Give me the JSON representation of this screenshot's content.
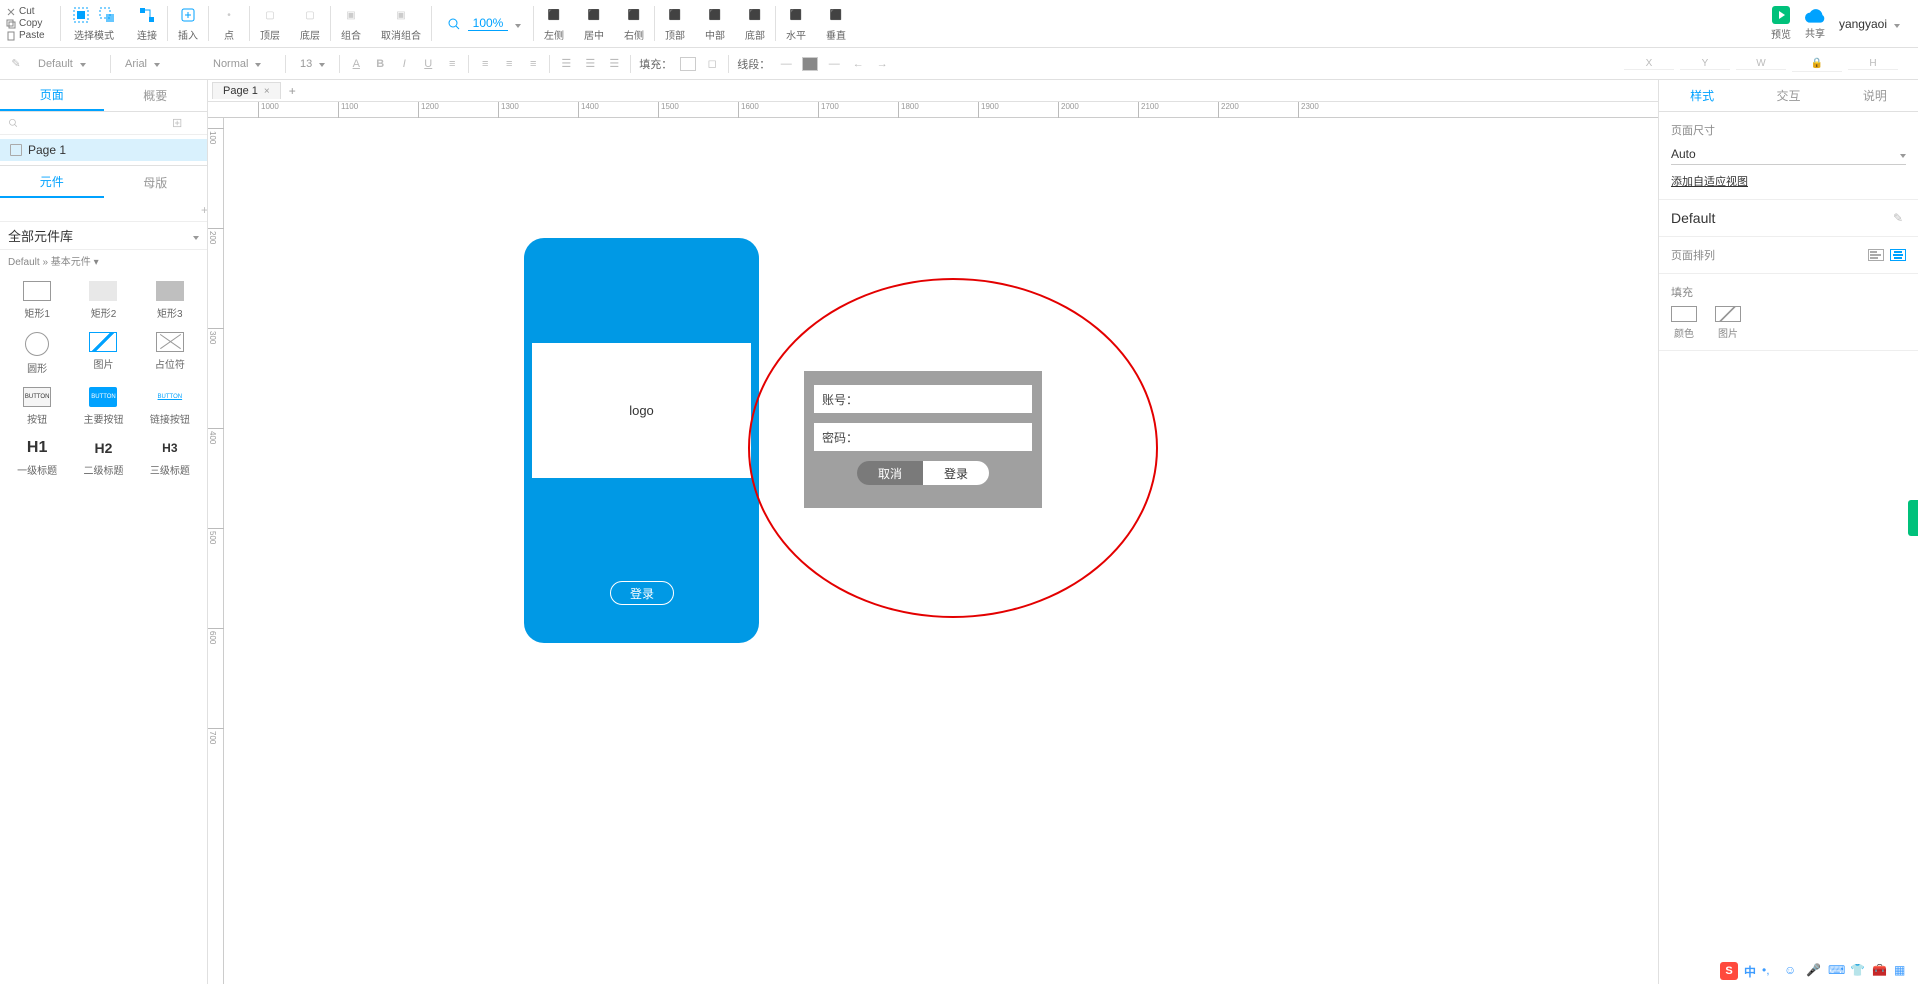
{
  "clipboard": {
    "cut": "Cut",
    "copy": "Copy",
    "paste": "Paste"
  },
  "toolbar": {
    "select_mode": "选择模式",
    "connect": "连接",
    "insert": "插入",
    "point": "点",
    "top_layer": "顶层",
    "bottom_layer": "底层",
    "group": "组合",
    "ungroup": "取消组合",
    "zoom": "100%",
    "align_left": "左侧",
    "align_center": "居中",
    "align_right": "右侧",
    "align_top": "顶部",
    "align_middle": "中部",
    "align_bottom": "底部",
    "dist_h": "水平",
    "dist_v": "垂直",
    "preview": "预览",
    "share": "共享",
    "user": "yangyaoi"
  },
  "toolbar2": {
    "style_default": "Default",
    "font": "Arial",
    "weight": "Normal",
    "size": "13",
    "fill_label": "填充：",
    "stroke_label": "线段："
  },
  "xywh": {
    "x": "X",
    "y": "Y",
    "w": "W",
    "h": "H"
  },
  "left": {
    "tab_pages": "页面",
    "tab_outline": "概要",
    "page_name": "Page 1",
    "tab_widgets": "元件",
    "tab_masters": "母版",
    "library": "全部元件库",
    "crumb": "Default » 基本元件 ▾",
    "widgets": {
      "rect1": "矩形1",
      "rect2": "矩形2",
      "rect3": "矩形3",
      "circle": "圆形",
      "image": "图片",
      "placeholder": "占位符",
      "button": "按钮",
      "primary_button": "主要按钮",
      "link_button": "链接按钮",
      "h1": "一级标题",
      "h2": "二级标题",
      "h3": "三级标题",
      "btn_text": "BUTTON"
    },
    "h1": "H1",
    "h2": "H2",
    "h3": "H3"
  },
  "canvas": {
    "tab": "Page 1",
    "ruler_h": [
      "1000",
      "1100",
      "1200",
      "1300",
      "1400",
      "1500",
      "1600",
      "1700",
      "1800",
      "1900",
      "2000",
      "2100",
      "2200",
      "2300"
    ],
    "ruler_v": [
      "100",
      "200",
      "300",
      "400",
      "500",
      "600",
      "700"
    ],
    "logo_text": "logo",
    "phone_login": "登录",
    "dialog": {
      "account": "账号：",
      "password": "密码：",
      "cancel": "取消",
      "login": "登录"
    }
  },
  "right": {
    "tab_style": "样式",
    "tab_interact": "交互",
    "tab_notes": "说明",
    "page_size_label": "页面尺寸",
    "page_size_value": "Auto",
    "add_adaptive": "添加自适应视图",
    "default": "Default",
    "page_align_label": "页面排列",
    "fill_label": "填充",
    "fill_color": "颜色",
    "fill_image": "图片"
  },
  "ime": {
    "han": "中"
  }
}
